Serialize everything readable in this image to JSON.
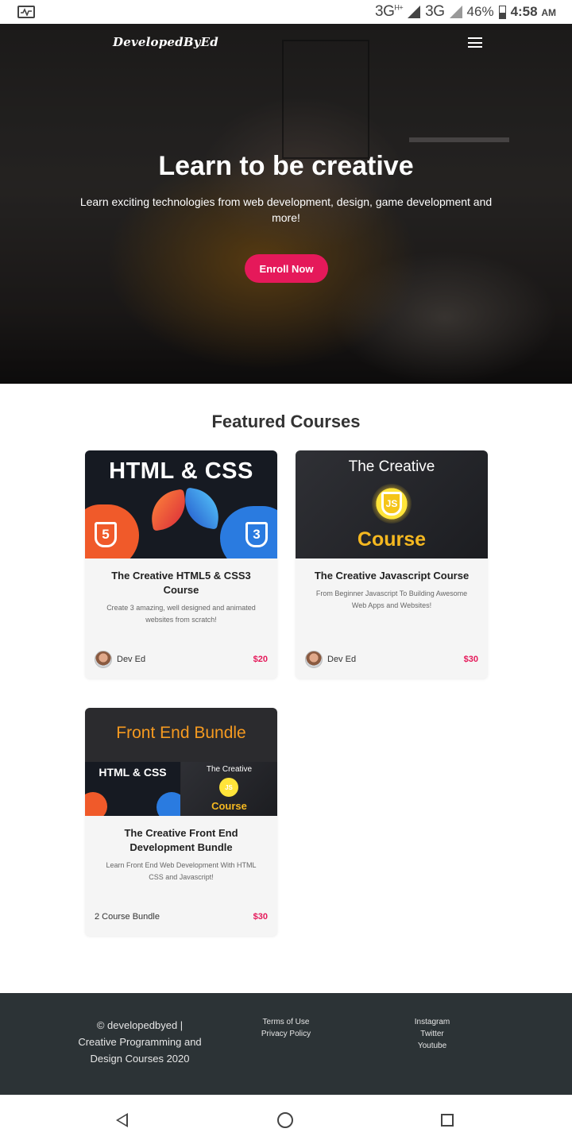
{
  "status_bar": {
    "network_1": "3G",
    "network_1_sup": "H+",
    "network_2": "3G",
    "battery": "46%",
    "time": "4:58",
    "ampm": "AM"
  },
  "header": {
    "logo": "DevelopedByEd"
  },
  "hero": {
    "title": "Learn to be creative",
    "subtitle": "Learn exciting technologies from web development, design, game development and more!",
    "cta": "Enroll Now"
  },
  "featured": {
    "title": "Featured Courses",
    "courses": [
      {
        "thumb_heading": "HTML & CSS",
        "title": "The Creative HTML5 & CSS3 Course",
        "description": "Create 3 amazing, well designed and animated websites from scratch!",
        "author": "Dev Ed",
        "price": "$20"
      },
      {
        "thumb_top": "The Creative",
        "thumb_badge": "JS",
        "thumb_bottom": "Course",
        "title": "The Creative Javascript Course",
        "description": "From Beginner Javascript To Building Awesome Web Apps and Websites!",
        "author": "Dev Ed",
        "price": "$30"
      },
      {
        "thumb_heading": "Front End Bundle",
        "thumb_left": "HTML & CSS",
        "thumb_right_top": "The Creative",
        "thumb_right_bottom": "Course",
        "title": "The Creative Front End Development Bundle",
        "description": "Learn Front End Web Development With HTML CSS and Javascript!",
        "label": "2 Course Bundle",
        "price": "$30"
      }
    ]
  },
  "footer": {
    "copyright": "© developedbyed | Creative Programming and Design Courses 2020",
    "legal_links": [
      "Terms of Use",
      "Privacy Policy"
    ],
    "social_links": [
      "Instagram",
      "Twitter",
      "Youtube"
    ]
  },
  "colors": {
    "accent": "#e5195a",
    "footer_bg": "#2c3336"
  }
}
